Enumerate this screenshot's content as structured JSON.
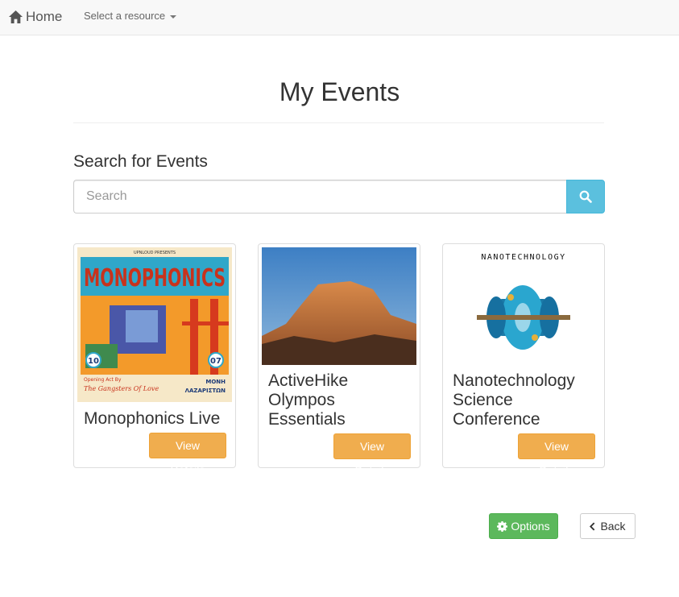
{
  "navbar": {
    "home_label": "Home",
    "resource_label": "Select a resource"
  },
  "page": {
    "title": "My Events"
  },
  "search": {
    "heading": "Search for Events",
    "placeholder": "Search",
    "value": ""
  },
  "events": [
    {
      "title": "Monophonics Live",
      "button_label": "View Details",
      "poster": {
        "top_text": "UPNLOUD PRESENTS",
        "band": "MONOPHONICS",
        "date_left": "10",
        "date_right": "07",
        "support": "The Gangsters Of Love",
        "opening": "Opening Act By",
        "venue_line1": "ΜΟΝΗ",
        "venue_line2": "ΛΑΖΑΡΙΣΤΩΝ"
      }
    },
    {
      "title": "ActiveHike Olympos Essentials",
      "button_label": "View Details"
    },
    {
      "title": "Nanotechnology Science Conference",
      "button_label": "View Details",
      "image_label": "NANOTECHNOLOGY"
    }
  ],
  "actions": {
    "options_label": "Options",
    "back_label": "Back"
  },
  "colors": {
    "info": "#5bc0de",
    "warning": "#f0ad4e",
    "success": "#5cb85c"
  }
}
